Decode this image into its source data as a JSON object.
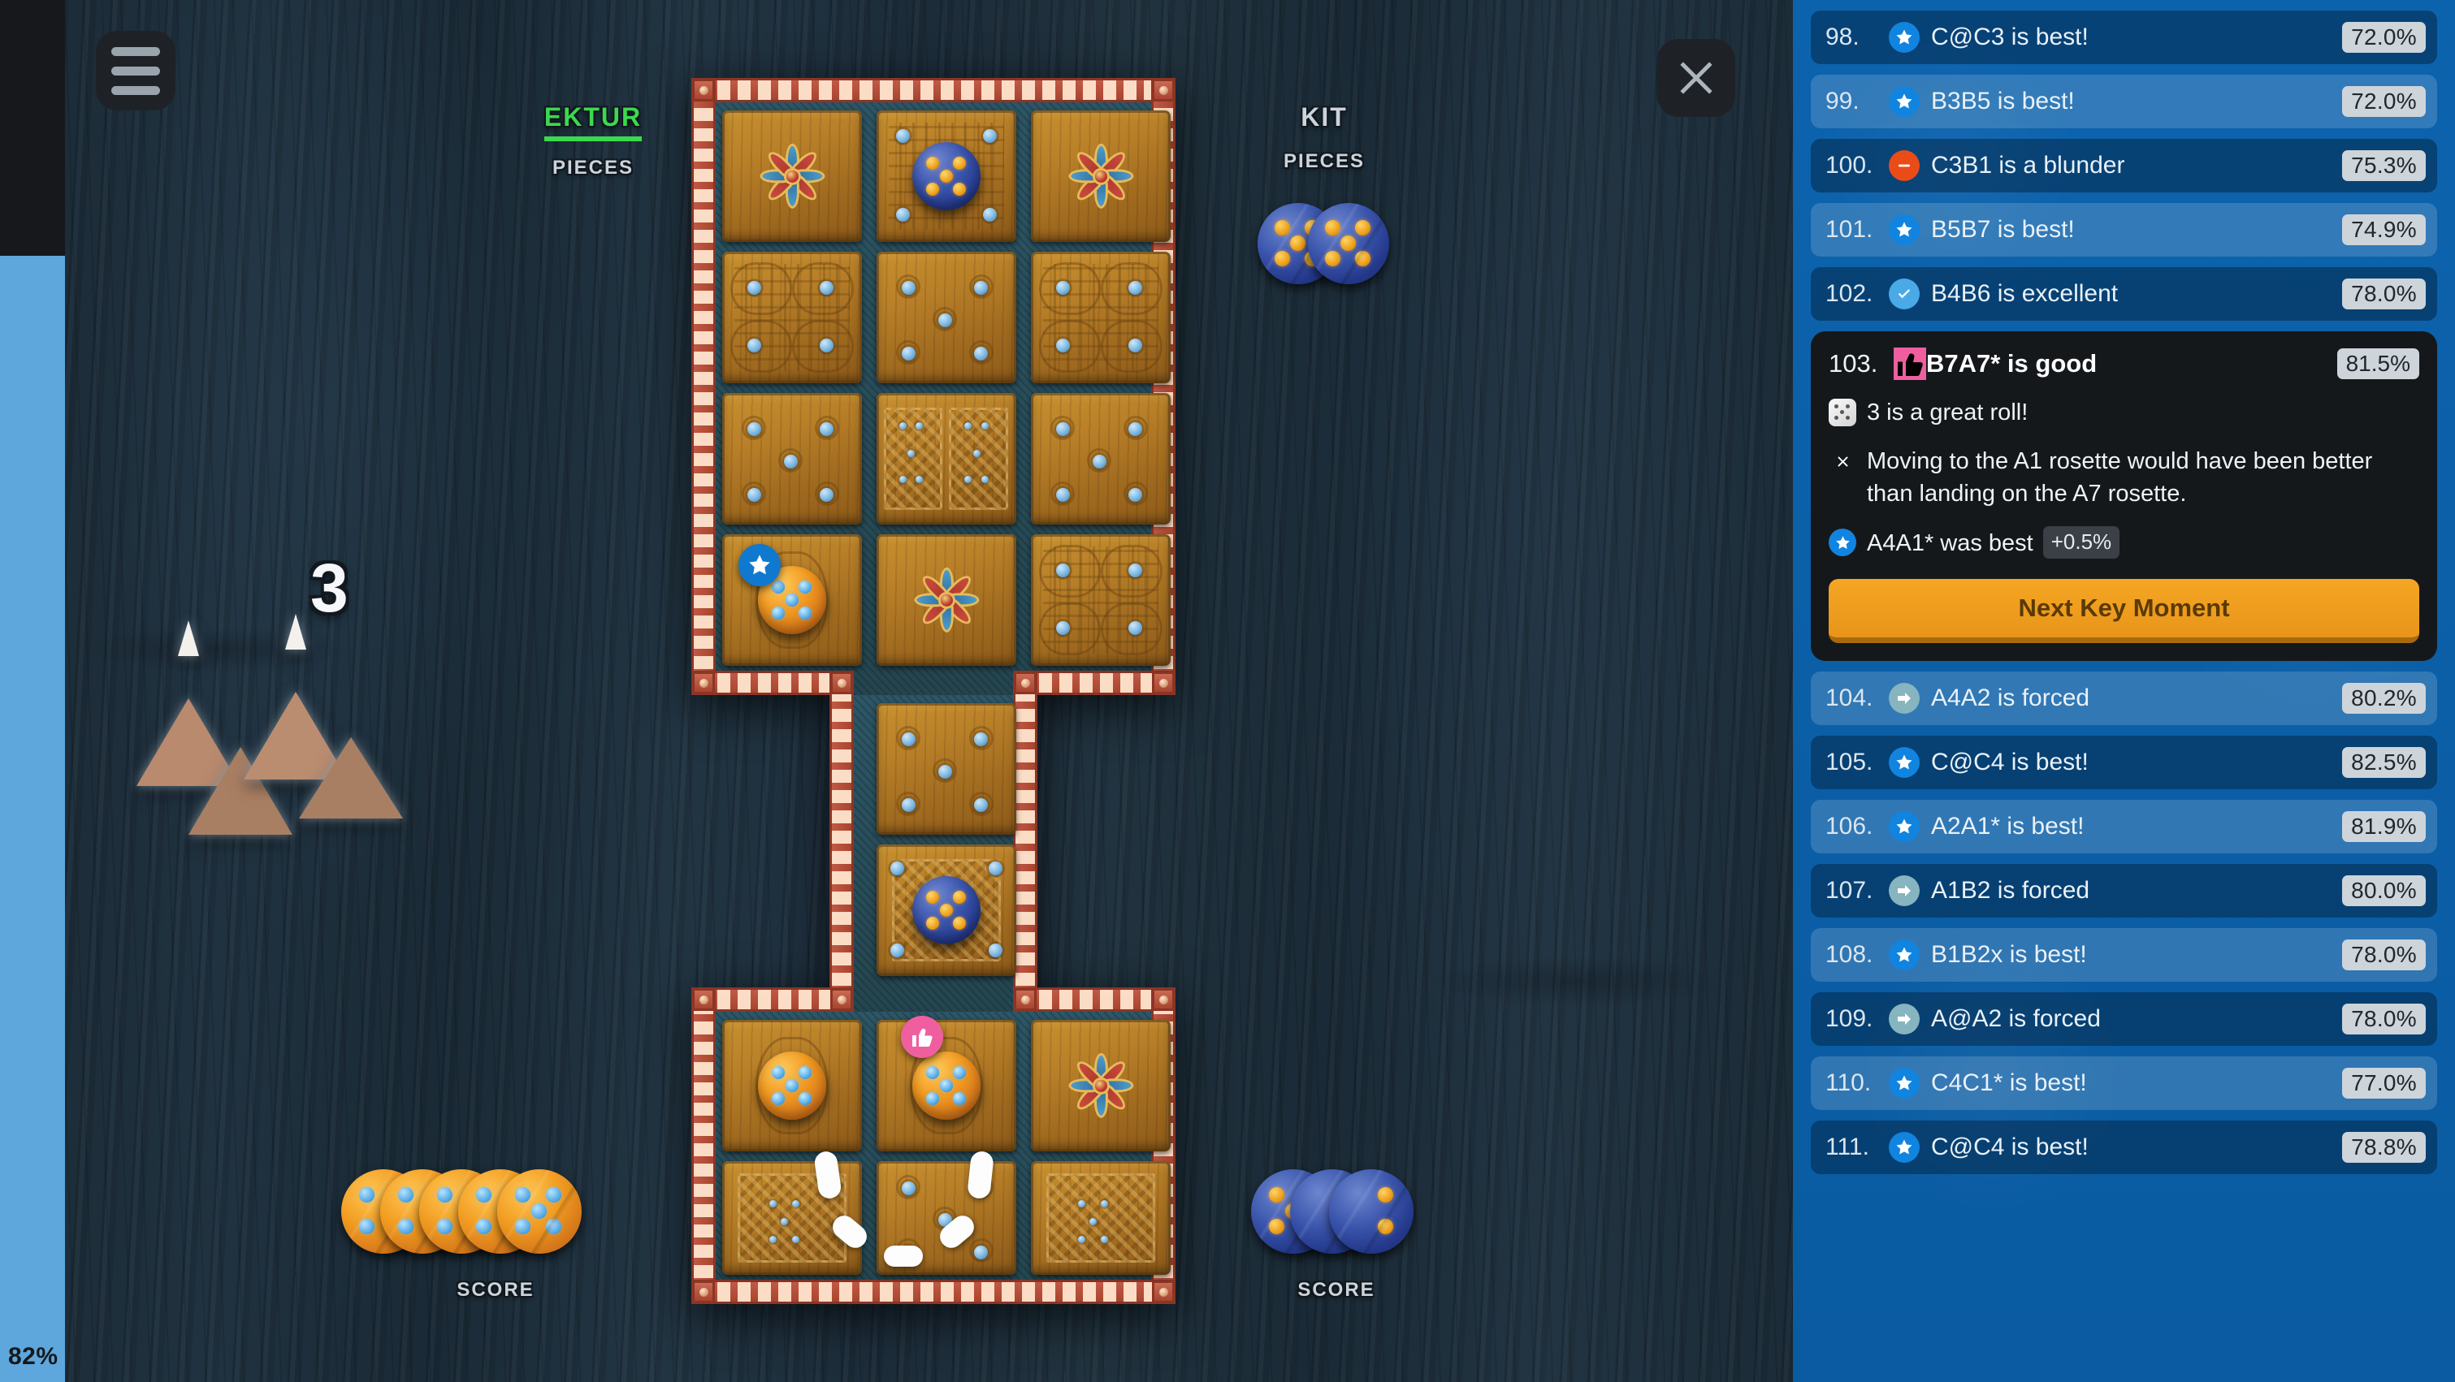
{
  "win_probability": {
    "label": "82%",
    "color": "#5da7dd"
  },
  "controls": {
    "menu_icon": "hamburger-menu-icon",
    "close_icon": "close-icon"
  },
  "players": {
    "left": {
      "name": "Ektur",
      "pieces_label": "Pieces",
      "score_label": "Score",
      "is_turn": true,
      "color": "#3bd94f",
      "pieces_remaining": 0,
      "score": 5,
      "token_color": "orange"
    },
    "right": {
      "name": "Kit",
      "pieces_label": "Pieces",
      "score_label": "Score",
      "is_turn": false,
      "color": "#ccd3da",
      "pieces_remaining": 2,
      "score": 3,
      "token_color": "blue"
    }
  },
  "dice": {
    "roll_value": "3",
    "dice_count": 4,
    "marked": [
      true,
      false,
      true,
      false
    ]
  },
  "board": {
    "rosettes": [
      "r0c0",
      "r0c2",
      "r3c1",
      "r7c0",
      "r7c2"
    ],
    "pieces": [
      {
        "cell": "r0c1",
        "color": "blue"
      },
      {
        "cell": "r3c0",
        "color": "orange",
        "badge": "star"
      },
      {
        "cell": "r5c1",
        "color": "blue"
      },
      {
        "cell": "r6c0",
        "color": "orange"
      },
      {
        "cell": "r6c1",
        "color": "orange",
        "badge": "thumb"
      }
    ]
  },
  "sidebar": {
    "moves": [
      {
        "num": "98.",
        "icon": "star",
        "text": "C@C3 is best!",
        "pct": "72.0%"
      },
      {
        "num": "99.",
        "icon": "star",
        "text": "B3B5 is best!",
        "pct": "72.0%"
      },
      {
        "num": "100.",
        "icon": "minus",
        "text": "C3B1 is a blunder",
        "pct": "75.3%"
      },
      {
        "num": "101.",
        "icon": "star",
        "text": "B5B7 is best!",
        "pct": "74.9%"
      },
      {
        "num": "102.",
        "icon": "check",
        "text": "B4B6 is excellent",
        "pct": "78.0%"
      }
    ],
    "key_moment": {
      "num": "103.",
      "icon": "thumb",
      "text": "B7A7* is good",
      "pct": "81.5%",
      "lines": [
        {
          "icon": "dice",
          "text": "3 is a great roll!"
        },
        {
          "icon": "cross",
          "text": "Moving to the A1 rosette would have been better than landing on the A7 rosette."
        },
        {
          "icon": "star",
          "text": "A4A1* was best",
          "pill": "+0.5%"
        }
      ],
      "next_button": "Next Key Moment"
    },
    "moves_after": [
      {
        "num": "104.",
        "icon": "arrow",
        "text": "A4A2 is forced",
        "pct": "80.2%"
      },
      {
        "num": "105.",
        "icon": "star",
        "text": "C@C4 is best!",
        "pct": "82.5%"
      },
      {
        "num": "106.",
        "icon": "star",
        "text": "A2A1* is best!",
        "pct": "81.9%"
      },
      {
        "num": "107.",
        "icon": "arrow",
        "text": "A1B2 is forced",
        "pct": "80.0%"
      },
      {
        "num": "108.",
        "icon": "star",
        "text": "B1B2x is best!",
        "pct": "78.0%"
      },
      {
        "num": "109.",
        "icon": "arrow",
        "text": "A@A2 is forced",
        "pct": "78.0%"
      },
      {
        "num": "110.",
        "icon": "star",
        "text": "C4C1* is best!",
        "pct": "77.0%"
      },
      {
        "num": "111.",
        "icon": "star",
        "text": "C@C4 is best!",
        "pct": "78.8%"
      }
    ]
  }
}
